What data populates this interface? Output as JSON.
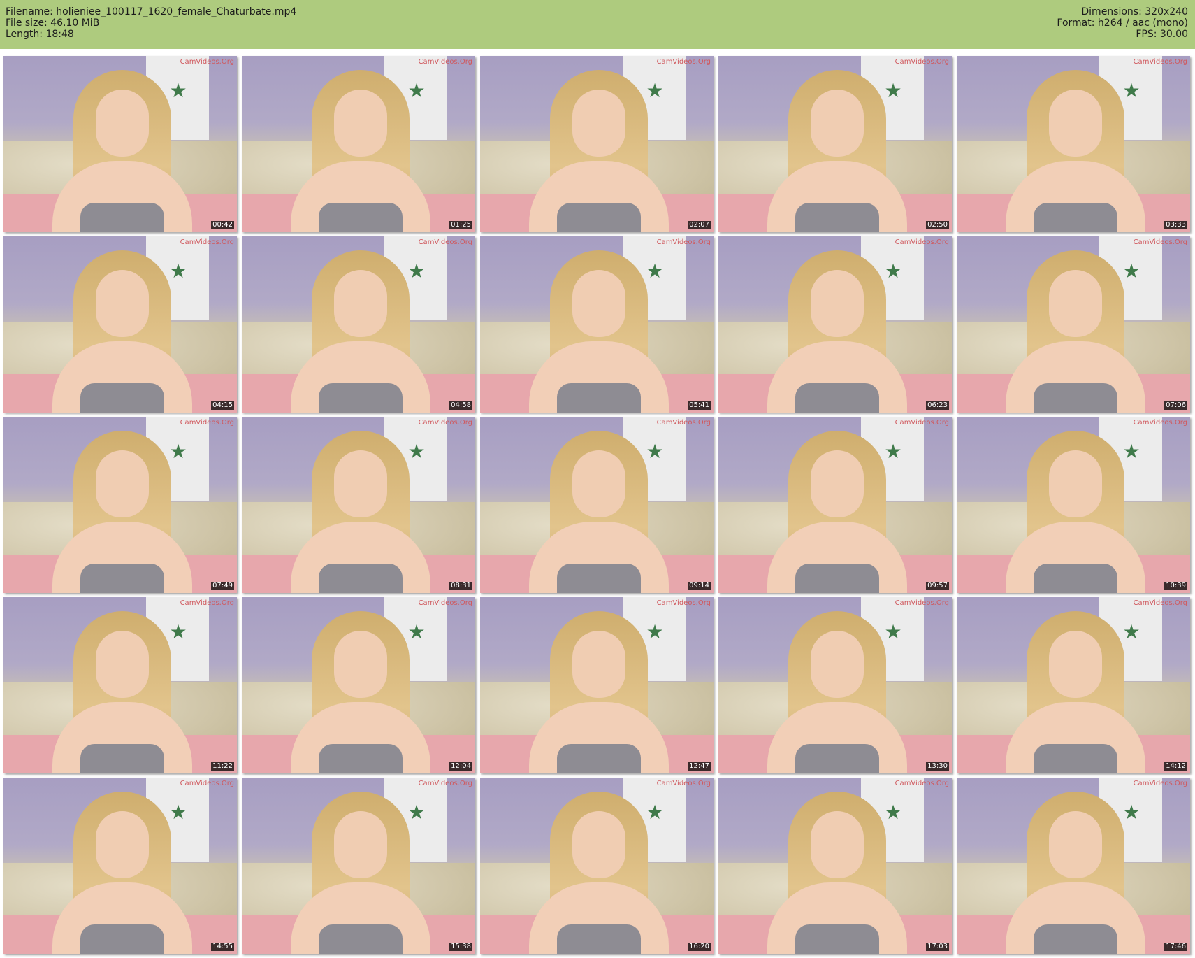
{
  "header": {
    "filename": "Filename: holieniee_100117_1620_female_Chaturbate.mp4",
    "file_size": "File size: 46.10 MiB",
    "length": "Length: 18:48",
    "dimensions": "Dimensions: 320x240",
    "format": "Format: h264 / aac (mono)",
    "fps": "FPS: 30.00"
  },
  "colors": {
    "header_bg": "#aecb7e"
  },
  "watermark": "CamVideos.Org",
  "thumbnails": [
    {
      "time": "00:42"
    },
    {
      "time": "01:25"
    },
    {
      "time": "02:07"
    },
    {
      "time": "02:50"
    },
    {
      "time": "03:33"
    },
    {
      "time": "04:15"
    },
    {
      "time": "04:58"
    },
    {
      "time": "05:41"
    },
    {
      "time": "06:23"
    },
    {
      "time": "07:06"
    },
    {
      "time": "07:49"
    },
    {
      "time": "08:31"
    },
    {
      "time": "09:14"
    },
    {
      "time": "09:57"
    },
    {
      "time": "10:39"
    },
    {
      "time": "11:22"
    },
    {
      "time": "12:04"
    },
    {
      "time": "12:47"
    },
    {
      "time": "13:30"
    },
    {
      "time": "14:12"
    },
    {
      "time": "14:55"
    },
    {
      "time": "15:38"
    },
    {
      "time": "16:20"
    },
    {
      "time": "17:03"
    },
    {
      "time": "17:46"
    }
  ]
}
